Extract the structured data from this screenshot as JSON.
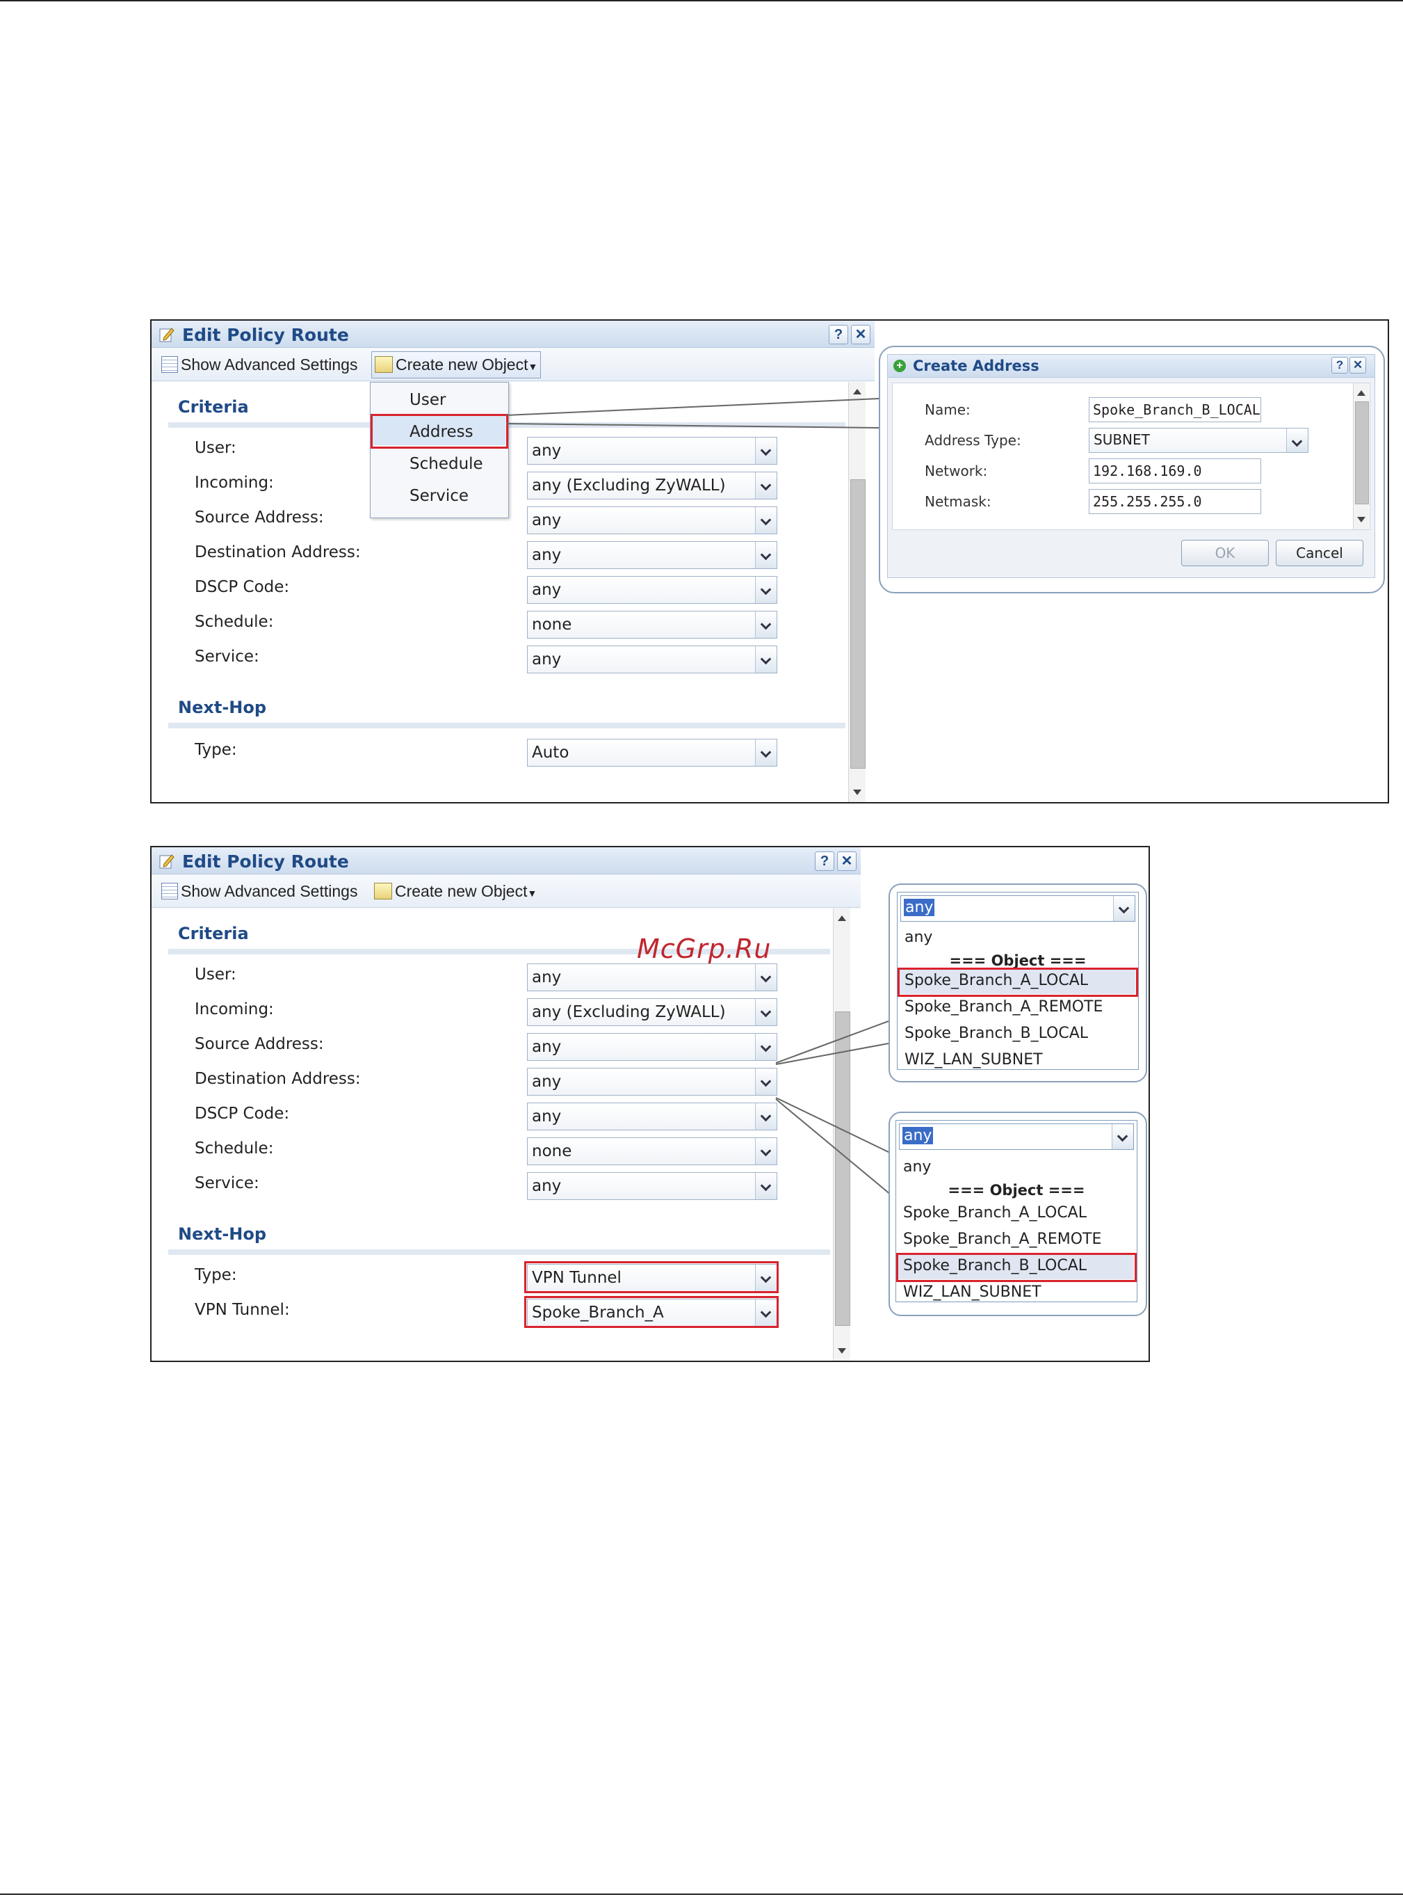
{
  "colors": {
    "title_blue": "#1f4a86",
    "highlight_red": "#d9232d",
    "selection_blue": "#3a6cc8"
  },
  "figure1": {
    "dialog": {
      "title": "Edit Policy Route",
      "help_btn": "?",
      "close_btn": "✕",
      "toolbar": {
        "advanced": "Show Advanced Settings",
        "create_object": "Create new Object"
      },
      "menu": [
        "User",
        "Address",
        "Schedule",
        "Service"
      ],
      "criteria_title": "Criteria",
      "fields": [
        {
          "label": "User:",
          "value": "any"
        },
        {
          "label": "Incoming:",
          "value": "any (Excluding ZyWALL)"
        },
        {
          "label": "Source Address:",
          "value": "any"
        },
        {
          "label": "Destination Address:",
          "value": "any"
        },
        {
          "label": "DSCP Code:",
          "value": "any"
        },
        {
          "label": "Schedule:",
          "value": "none"
        },
        {
          "label": "Service:",
          "value": "any"
        }
      ],
      "nexthop_title": "Next-Hop",
      "type_label": "Type:",
      "type_value": "Auto"
    },
    "create_address": {
      "title": "Create Address",
      "help_btn": "?",
      "close_btn": "✕",
      "name_label": "Name:",
      "name_value": "Spoke_Branch_B_LOCAL",
      "type_label": "Address Type:",
      "type_value": "SUBNET",
      "network_label": "Network:",
      "network_value": "192.168.169.0",
      "netmask_label": "Netmask:",
      "netmask_value": "255.255.255.0",
      "ok": "OK",
      "cancel": "Cancel"
    }
  },
  "figure2": {
    "dialog": {
      "title": "Edit Policy Route",
      "help_btn": "?",
      "close_btn": "✕",
      "toolbar": {
        "advanced": "Show Advanced Settings",
        "create_object": "Create new Object"
      },
      "criteria_title": "Criteria",
      "fields": [
        {
          "label": "User:",
          "value": "any"
        },
        {
          "label": "Incoming:",
          "value": "any (Excluding ZyWALL)"
        },
        {
          "label": "Source Address:",
          "value": "any"
        },
        {
          "label": "Destination Address:",
          "value": "any"
        },
        {
          "label": "DSCP Code:",
          "value": "any"
        },
        {
          "label": "Schedule:",
          "value": "none"
        },
        {
          "label": "Service:",
          "value": "any"
        }
      ],
      "nexthop_title": "Next-Hop",
      "type_label": "Type:",
      "type_value": "VPN Tunnel",
      "tunnel_label": "VPN Tunnel:",
      "tunnel_value": "Spoke_Branch_A"
    },
    "dropdown_source": {
      "selected": "any",
      "options": [
        "any",
        "=== Object ===",
        "Spoke_Branch_A_LOCAL",
        "Spoke_Branch_A_REMOTE",
        "Spoke_Branch_B_LOCAL",
        "WIZ_LAN_SUBNET"
      ]
    },
    "dropdown_destination": {
      "selected": "any",
      "options": [
        "any",
        "=== Object ===",
        "Spoke_Branch_A_LOCAL",
        "Spoke_Branch_A_REMOTE",
        "Spoke_Branch_B_LOCAL",
        "WIZ_LAN_SUBNET"
      ]
    }
  },
  "watermark": "McGrp.Ru"
}
